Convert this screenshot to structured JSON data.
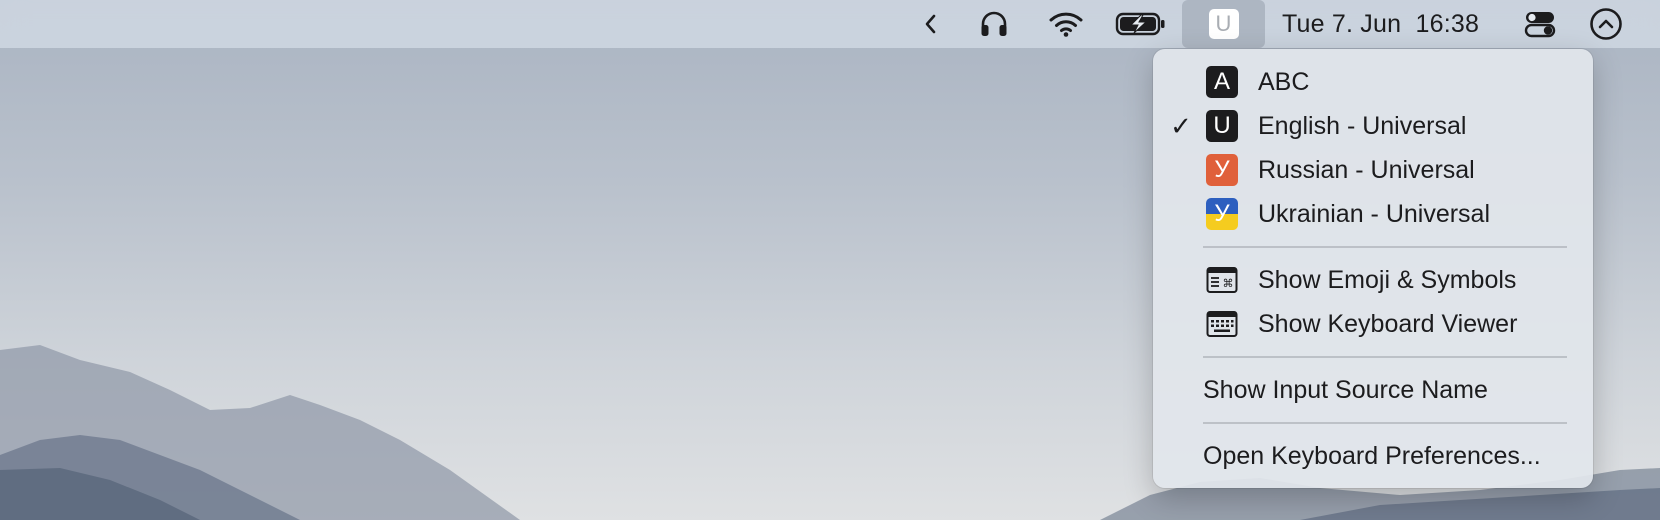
{
  "menubar": {
    "clock": "Tue 7. Jun  16:38",
    "input_badge": "U",
    "icons": [
      "chevron-left-icon",
      "headphones-icon",
      "wifi-icon",
      "battery-charging-icon",
      "input-source-icon",
      "control-center-icon",
      "siri-icon"
    ]
  },
  "menu": {
    "sources": [
      {
        "badge": "A",
        "label": "ABC",
        "checked": false,
        "color": "#1c1c1e"
      },
      {
        "badge": "U",
        "label": "English - Universal",
        "checked": true,
        "color": "#1c1c1e"
      },
      {
        "badge": "У",
        "label": "Russian - Universal",
        "checked": false,
        "color": "#e0603a"
      },
      {
        "badge": "У",
        "label": "Ukrainian - Universal",
        "checked": false,
        "color": "flag-ua"
      }
    ],
    "checkmark": "✓",
    "tools": [
      {
        "label": "Show Emoji & Symbols",
        "icon": "emoji-symbols-icon"
      },
      {
        "label": "Show Keyboard Viewer",
        "icon": "keyboard-viewer-icon"
      }
    ],
    "show_name": "Show Input Source Name",
    "open_prefs": "Open Keyboard Preferences..."
  }
}
